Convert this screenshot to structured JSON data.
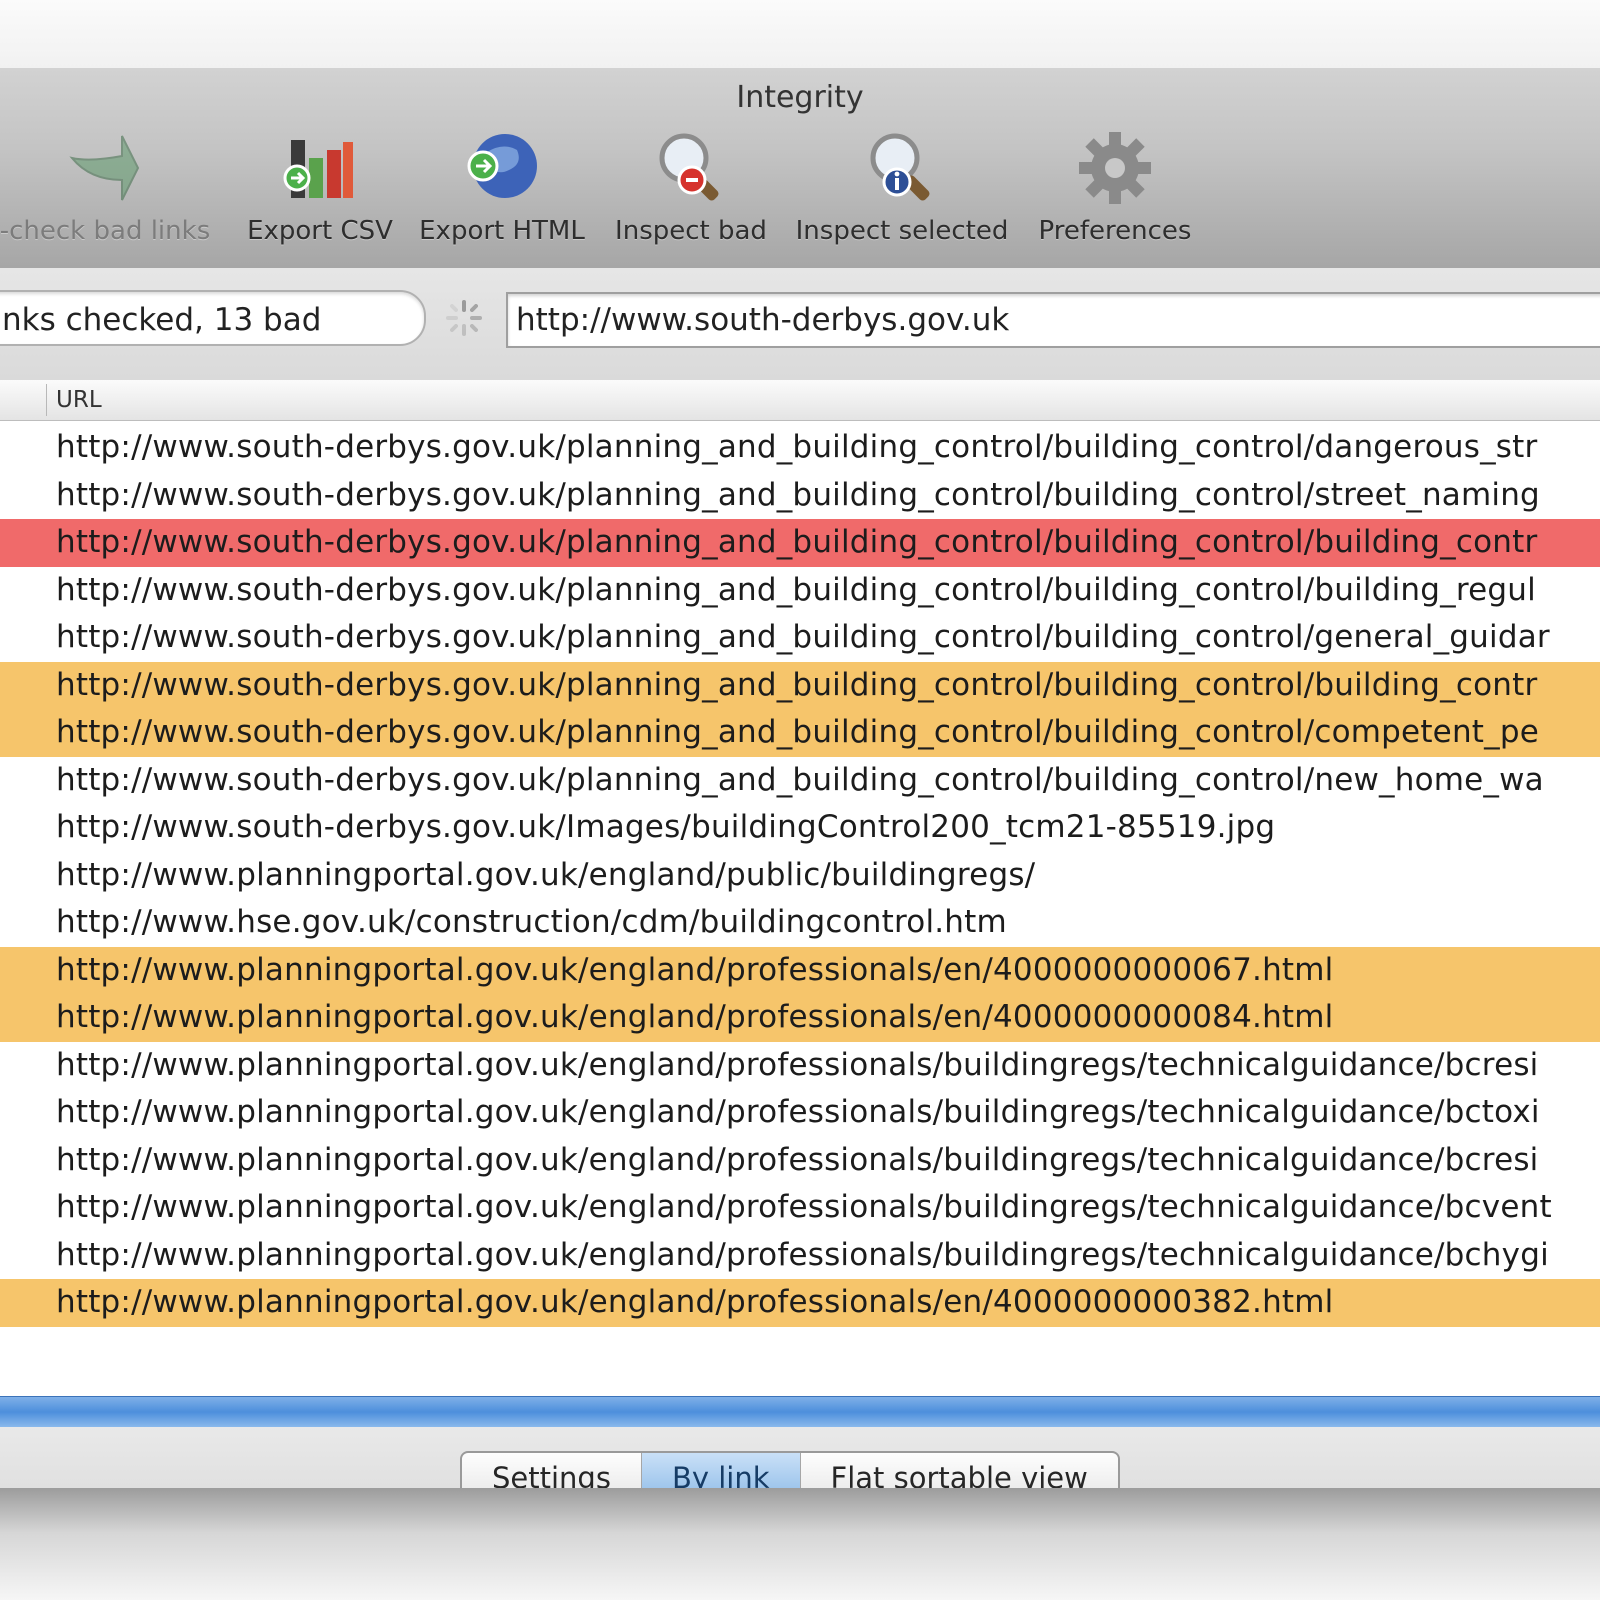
{
  "window": {
    "title": "Integrity"
  },
  "toolbar": {
    "items": [
      {
        "label": "-check bad links",
        "icon": "recheck-arrow-icon"
      },
      {
        "label": "Export CSV",
        "icon": "export-csv-chart-icon"
      },
      {
        "label": "Export HTML",
        "icon": "export-html-globe-icon"
      },
      {
        "label": "Inspect bad",
        "icon": "inspect-bad-magnifier-icon"
      },
      {
        "label": "Inspect selected",
        "icon": "inspect-selected-magnifier-icon"
      },
      {
        "label": "Preferences",
        "icon": "gear-icon"
      }
    ]
  },
  "status": {
    "text": "nks checked, 13 bad"
  },
  "url_field": {
    "value": "http://www.south-derbys.gov.uk"
  },
  "table": {
    "header": "URL",
    "rows": [
      {
        "url": "http://www.south-derbys.gov.uk/planning_and_building_control/building_control/dangerous_str",
        "status": "ok"
      },
      {
        "url": "http://www.south-derbys.gov.uk/planning_and_building_control/building_control/street_naming",
        "status": "ok"
      },
      {
        "url": "http://www.south-derbys.gov.uk/planning_and_building_control/building_control/building_contr",
        "status": "bad"
      },
      {
        "url": "http://www.south-derbys.gov.uk/planning_and_building_control/building_control/building_regul",
        "status": "ok"
      },
      {
        "url": "http://www.south-derbys.gov.uk/planning_and_building_control/building_control/general_guidar",
        "status": "ok"
      },
      {
        "url": "http://www.south-derbys.gov.uk/planning_and_building_control/building_control/building_contr",
        "status": "warning"
      },
      {
        "url": "http://www.south-derbys.gov.uk/planning_and_building_control/building_control/competent_pe",
        "status": "warning"
      },
      {
        "url": "http://www.south-derbys.gov.uk/planning_and_building_control/building_control/new_home_wa",
        "status": "ok"
      },
      {
        "url": "http://www.south-derbys.gov.uk/Images/buildingControl200_tcm21-85519.jpg",
        "status": "ok"
      },
      {
        "url": "http://www.planningportal.gov.uk/england/public/buildingregs/",
        "status": "ok"
      },
      {
        "url": "http://www.hse.gov.uk/construction/cdm/buildingcontrol.htm",
        "status": "ok"
      },
      {
        "url": "http://www.planningportal.gov.uk/england/professionals/en/4000000000067.html",
        "status": "warning"
      },
      {
        "url": "http://www.planningportal.gov.uk/england/professionals/en/4000000000084.html",
        "status": "warning"
      },
      {
        "url": "http://www.planningportal.gov.uk/england/professionals/buildingregs/technicalguidance/bcresi",
        "status": "ok"
      },
      {
        "url": "http://www.planningportal.gov.uk/england/professionals/buildingregs/technicalguidance/bctoxi",
        "status": "ok"
      },
      {
        "url": "http://www.planningportal.gov.uk/england/professionals/buildingregs/technicalguidance/bcresi",
        "status": "ok"
      },
      {
        "url": "http://www.planningportal.gov.uk/england/professionals/buildingregs/technicalguidance/bcvent",
        "status": "ok"
      },
      {
        "url": "http://www.planningportal.gov.uk/england/professionals/buildingregs/technicalguidance/bchygi",
        "status": "ok"
      },
      {
        "url": "http://www.planningportal.gov.uk/england/professionals/en/4000000000382.html",
        "status": "warning"
      }
    ]
  },
  "view_tabs": {
    "items": [
      "Settings",
      "By link",
      "Flat sortable view"
    ],
    "selected": "By link"
  },
  "colors": {
    "bad": "#f06a6a",
    "warning": "#f6c56b",
    "selection": "#4d8fdc"
  }
}
